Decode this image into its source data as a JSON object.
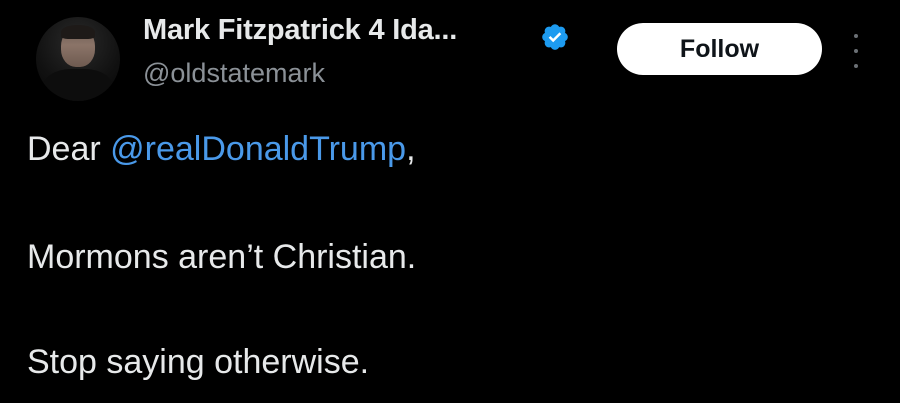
{
  "author": {
    "display_name": "Mark Fitzpatrick 4 Ida...",
    "handle": "@oldstatemark",
    "verified": true,
    "verified_color": "#1d9bf0"
  },
  "actions": {
    "follow_label": "Follow",
    "more_icon": "more-options-icon"
  },
  "tweet": {
    "line1_prefix": "Dear ",
    "line1_mention": "@realDonaldTrump",
    "line1_suffix": ",",
    "line2": "Mormons aren’t Christian.",
    "line3": "Stop saying otherwise."
  },
  "colors": {
    "background": "#000000",
    "text": "#e7e9ea",
    "handle": "#8b9197",
    "mention": "#4a99e9",
    "follow_bg": "#ffffff"
  }
}
